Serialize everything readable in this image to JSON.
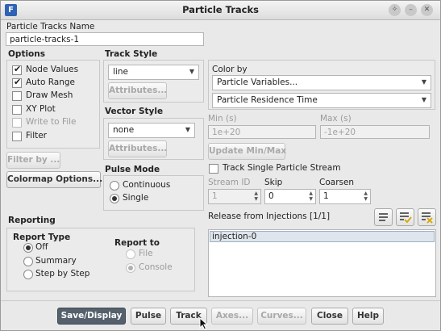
{
  "window": {
    "title": "Particle Tracks"
  },
  "name_section": {
    "label": "Particle Tracks Name",
    "value": "particle-tracks-1"
  },
  "options": {
    "heading": "Options",
    "items": [
      {
        "label": "Node Values",
        "checked": true,
        "enabled": true
      },
      {
        "label": "Auto Range",
        "checked": true,
        "enabled": true
      },
      {
        "label": "Draw Mesh",
        "checked": false,
        "enabled": true
      },
      {
        "label": "XY Plot",
        "checked": false,
        "enabled": true
      },
      {
        "label": "Write to File",
        "checked": false,
        "enabled": false
      },
      {
        "label": "Filter",
        "checked": false,
        "enabled": true
      }
    ],
    "filter_by_label": "Filter by ...",
    "colormap_label": "Colormap Options..."
  },
  "track_style": {
    "heading": "Track Style",
    "value": "line",
    "attributes_label": "Attributes..."
  },
  "vector_style": {
    "heading": "Vector Style",
    "value": "none",
    "attributes_label": "Attributes..."
  },
  "pulse_mode": {
    "heading": "Pulse Mode",
    "options": [
      {
        "label": "Continuous",
        "selected": false
      },
      {
        "label": "Single",
        "selected": true
      }
    ]
  },
  "color_by": {
    "heading": "Color by",
    "primary": "Particle Variables...",
    "secondary": "Particle Residence Time"
  },
  "range": {
    "min_label": "Min (s)",
    "min_value": "1e+20",
    "max_label": "Max (s)",
    "max_value": "-1e+20",
    "update_label": "Update Min/Max"
  },
  "single_stream": {
    "label": "Track Single Particle Stream",
    "checked": false,
    "stream_id_label": "Stream ID",
    "stream_id_value": "1",
    "skip_label": "Skip",
    "skip_value": "0",
    "coarsen_label": "Coarsen",
    "coarsen_value": "1"
  },
  "injections": {
    "heading": "Release from Injections",
    "count": "[1/1]",
    "items": [
      "injection-0"
    ],
    "icons": [
      "select-all-icon",
      "select-checked-icon",
      "deselect-all-icon"
    ]
  },
  "reporting": {
    "heading": "Reporting",
    "report_type": {
      "heading": "Report Type",
      "options": [
        {
          "label": "Off",
          "selected": true
        },
        {
          "label": "Summary",
          "selected": false
        },
        {
          "label": "Step by Step",
          "selected": false
        }
      ]
    },
    "report_to": {
      "heading": "Report to",
      "options": [
        {
          "label": "File",
          "selected": false
        },
        {
          "label": "Console",
          "selected": true
        }
      ]
    }
  },
  "buttons": {
    "save_display": "Save/Display",
    "pulse": "Pulse",
    "track": "Track",
    "axes": "Axes...",
    "curves": "Curves...",
    "close": "Close",
    "help": "Help"
  }
}
